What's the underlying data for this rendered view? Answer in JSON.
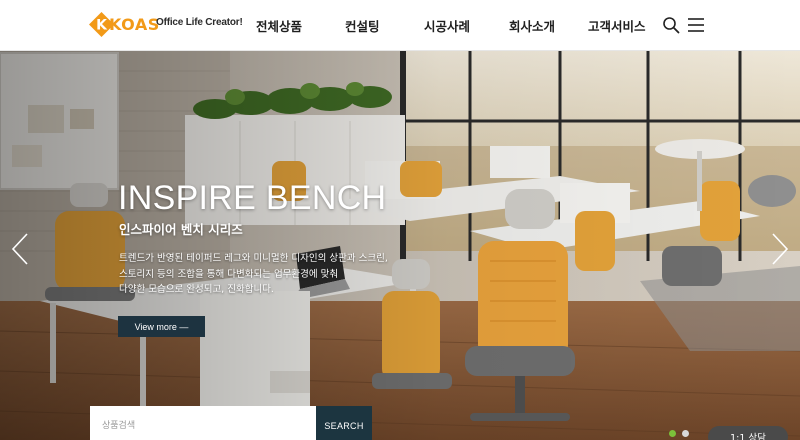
{
  "header": {
    "logo": "KOAS",
    "slogan": "Office Life Creator!",
    "nav": [
      {
        "label": "전체상품"
      },
      {
        "label": "컨설팅"
      },
      {
        "label": "시공사례"
      },
      {
        "label": "회사소개"
      },
      {
        "label": "고객서비스"
      }
    ],
    "icons": [
      "search-icon",
      "menu-icon"
    ]
  },
  "hero": {
    "title": "INSPIRE BENCH",
    "subtitle": "인스파이어 벤치 시리즈",
    "description": [
      "트렌드가 반영된 테이퍼드 레그와 미니멀한 디자인의 상판과 스크린,",
      "스토리지 등의 조합을 통해 다변화되는 업무환경에 맞춰",
      "다양한 모습으로 완성되고, 진화합니다."
    ],
    "view_more": "View more —",
    "slide_index": 0,
    "slide_count": 2
  },
  "search": {
    "placeholder": "상품검색",
    "button": "SEARCH"
  },
  "consult": "1:1 상담",
  "colors": {
    "accent": "#f29a18",
    "button_dark": "#1c3540",
    "dot_active": "#7cc13a",
    "chair_orange": "#e3a23a"
  }
}
